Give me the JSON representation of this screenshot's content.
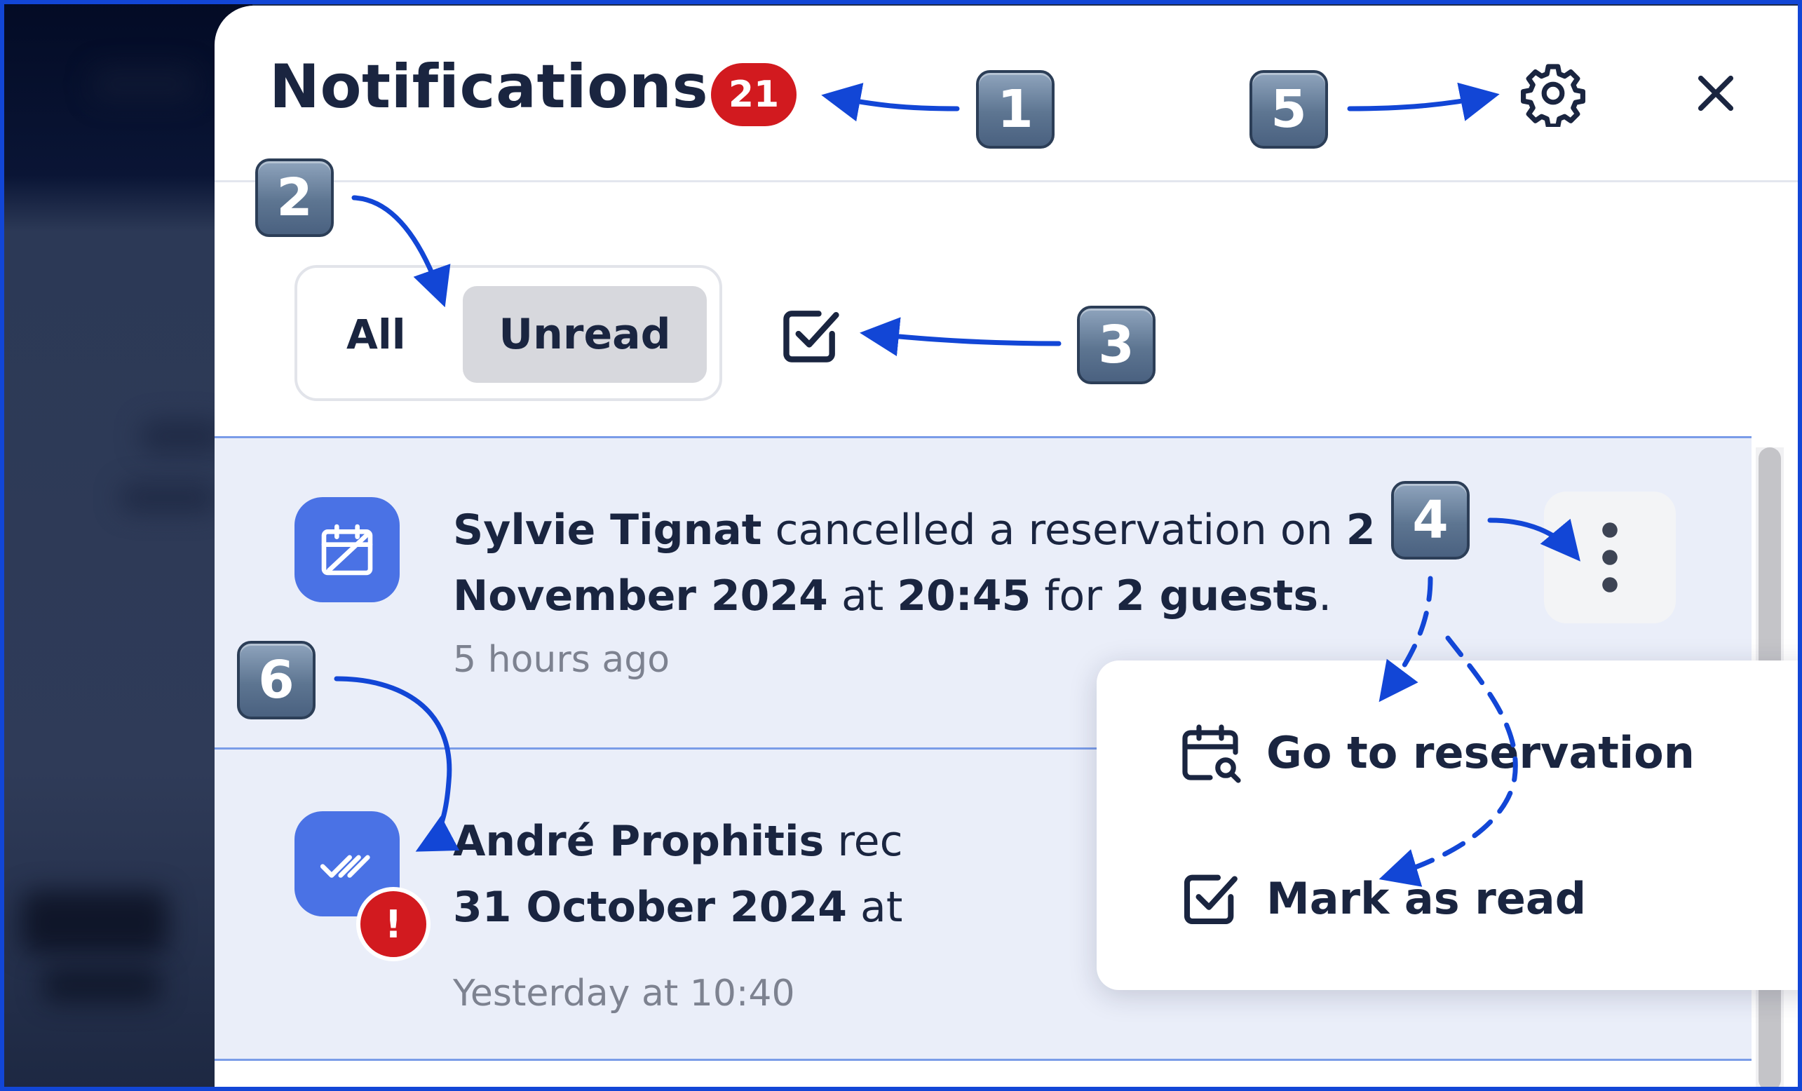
{
  "panel": {
    "title": "Notifications",
    "unread_count": "21"
  },
  "filters": {
    "all_label": "All",
    "unread_label": "Unread",
    "selected": "Unread"
  },
  "notifications": [
    {
      "actor": "Sylvie Tignat",
      "action": " cancelled a reservation on ",
      "date": "2 November 2024",
      "at": " at ",
      "time": "20:45",
      "for": " for ",
      "guests": "2 guests",
      "end": ".",
      "timestamp": "5 hours ago",
      "icon": "calendar-cancel-icon"
    },
    {
      "actor": "André Prophitis",
      "action": " rec",
      "date": "31 October 2024",
      "at": " at",
      "timestamp": "Yesterday at 10:40",
      "icon": "double-check-icon",
      "alert": "!"
    }
  ],
  "context_menu": {
    "items": [
      {
        "label": "Go to reservation",
        "icon": "calendar-search-icon"
      },
      {
        "label": "Mark as read",
        "icon": "checkbox-icon"
      }
    ]
  },
  "callouts": [
    "1",
    "2",
    "3",
    "4",
    "5",
    "6"
  ],
  "colors": {
    "accent_blue": "#4a72e5",
    "badge_red": "#d21a1f",
    "annotation_blue": "#1246d6",
    "unread_background": "#eaeef9"
  }
}
